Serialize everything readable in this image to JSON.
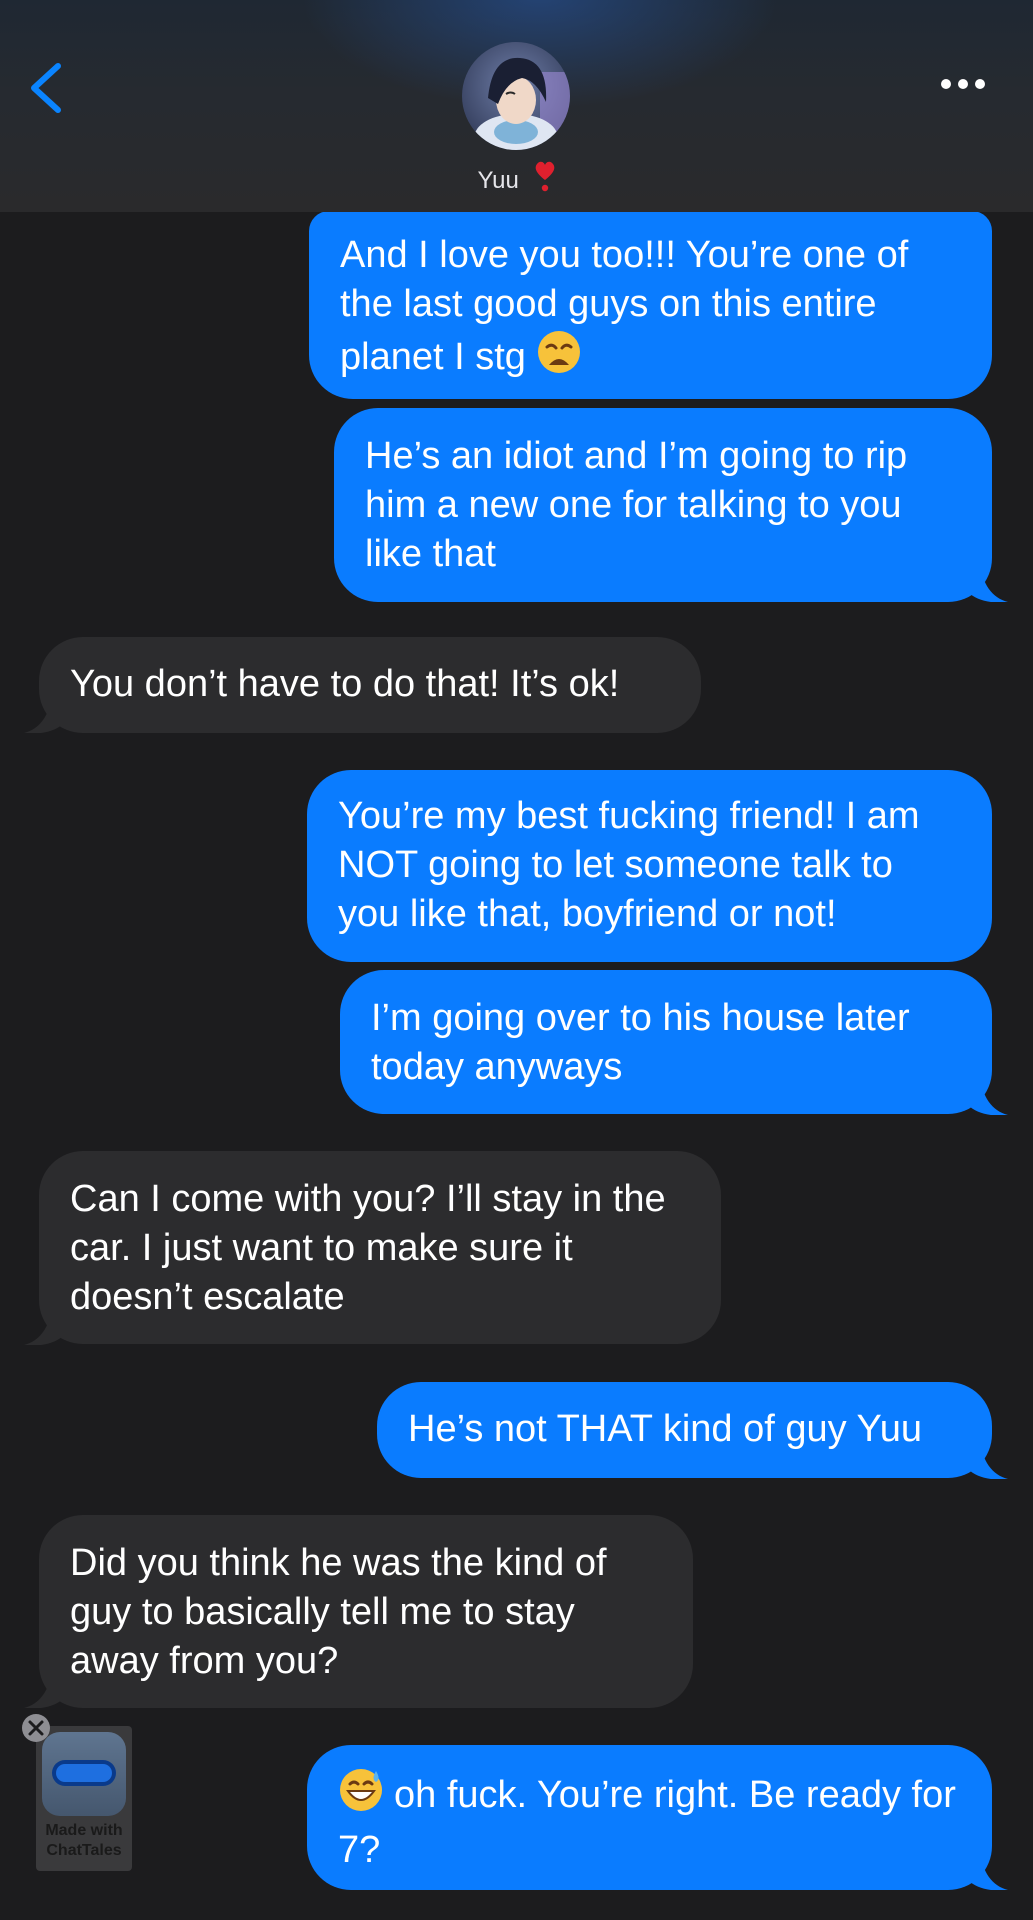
{
  "header": {
    "back_icon": "chevron-left-icon",
    "more_icon": "ellipsis-icon",
    "contact_name": "Yuu",
    "name_suffix_icon": "red-heart-exclamation-icon",
    "avatar_icon": "contact-avatar"
  },
  "messages": [
    {
      "side": "sent",
      "text": "And I love you too!!! You’re one of the last good guys on this entire planet I stg",
      "emoji": "weary-face-icon"
    },
    {
      "side": "sent",
      "text": "He’s an idiot and I’m going to rip him a new one for talking to you like that"
    },
    {
      "side": "received",
      "text": "You don’t have to do that! It’s ok!"
    },
    {
      "side": "sent",
      "text": "You’re my best fucking friend! I am NOT going to let someone talk to you like that, boyfriend or not!"
    },
    {
      "side": "sent",
      "text": "I’m going over to his house later today anyways"
    },
    {
      "side": "received",
      "text": "Can I come with you? I’ll stay in the car. I just want to make sure it doesn’t escalate"
    },
    {
      "side": "sent",
      "text": "He’s not THAT kind of guy Yuu"
    },
    {
      "side": "received",
      "text": "Did you think he was the kind of guy to basically tell me to stay away from you?"
    },
    {
      "side": "sent",
      "text": "oh fuck. You’re right. Be ready for 7?",
      "emoji": "grinning-sweat-face-icon"
    }
  ],
  "watermark": {
    "line1": "Made with",
    "line2": "ChatTales",
    "close_icon": "close-x-icon"
  },
  "colors": {
    "background": "#1c1c1e",
    "sent_bubble": "#0a7cff",
    "received_bubble": "#2c2c2e",
    "accent": "#0a84ff"
  }
}
